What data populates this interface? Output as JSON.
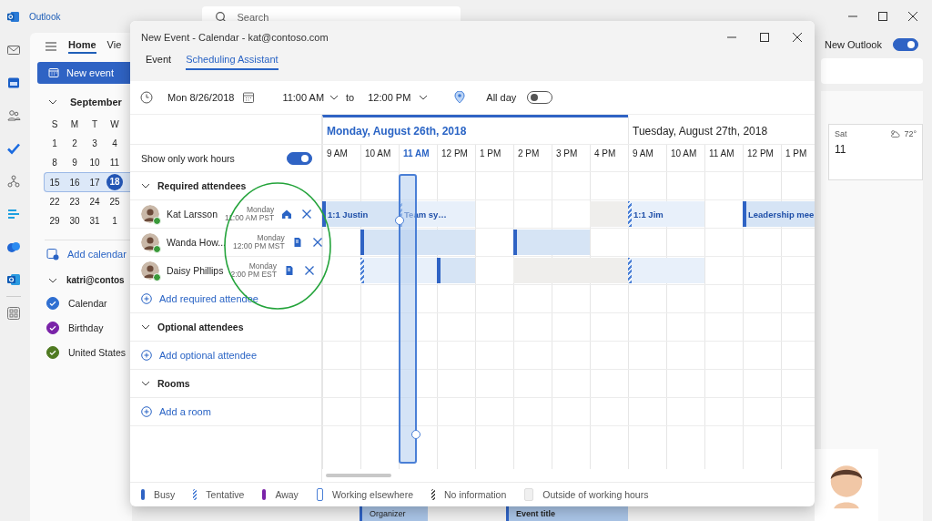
{
  "app": {
    "title": "Outlook",
    "search_placeholder": "Search",
    "new_outlook": {
      "label": "New Outlook",
      "on": true
    }
  },
  "ribbon": {
    "tabs": [
      {
        "label": "Home",
        "selected": true
      },
      {
        "label": "Vie",
        "selected": false
      }
    ],
    "new_event": "New event"
  },
  "mini_calendar": {
    "month": "September",
    "weekdays": [
      "S",
      "M",
      "T",
      "W"
    ],
    "weeks": [
      {
        "selected": false,
        "days": [
          {
            "day": "1",
            "today": false
          },
          {
            "day": "2",
            "today": false
          },
          {
            "day": "3",
            "today": false
          },
          {
            "day": "4",
            "today": false
          }
        ]
      },
      {
        "selected": false,
        "days": [
          {
            "day": "8",
            "today": false
          },
          {
            "day": "9",
            "today": false
          },
          {
            "day": "10",
            "today": false
          },
          {
            "day": "11",
            "today": false
          }
        ]
      },
      {
        "selected": true,
        "days": [
          {
            "day": "15",
            "today": false
          },
          {
            "day": "16",
            "today": false
          },
          {
            "day": "17",
            "today": false
          },
          {
            "day": "18",
            "today": true
          }
        ]
      },
      {
        "selected": false,
        "days": [
          {
            "day": "22",
            "today": false
          },
          {
            "day": "23",
            "today": false
          },
          {
            "day": "24",
            "today": false
          },
          {
            "day": "25",
            "today": false
          }
        ]
      },
      {
        "selected": false,
        "days": [
          {
            "day": "29",
            "today": false
          },
          {
            "day": "30",
            "today": false
          },
          {
            "day": "31",
            "today": false
          },
          {
            "day": "1",
            "today": false
          }
        ]
      }
    ]
  },
  "add_calendar": "Add calendar",
  "account": {
    "label": "katri@contos",
    "expanded": true
  },
  "calendars": [
    {
      "name": "Calendar",
      "color": "#2f6fd1",
      "checked": true
    },
    {
      "name": "Birthday",
      "color": "#7a23a8",
      "checked": true
    },
    {
      "name": "United States",
      "color": "#4f7a21",
      "checked": true
    }
  ],
  "right_pane": {
    "day": "Sat",
    "date": "11",
    "weather": "72°"
  },
  "background_events": [
    {
      "title": "Organizer"
    },
    {
      "title": "Event title"
    }
  ],
  "dialog": {
    "title": "New Event - Calendar - kat@contoso.com",
    "tabs": [
      {
        "label": "Event",
        "selected": false
      },
      {
        "label": "Scheduling Assistant",
        "selected": true
      }
    ],
    "date": "Mon 8/26/2018",
    "start": "11:00 AM",
    "to": "to",
    "end": "12:00 PM",
    "all_day": {
      "label": "All day",
      "on": false
    },
    "work_hours": {
      "label": "Show only work hours",
      "on": true
    },
    "days": [
      {
        "label": "Monday, August 26th, 2018",
        "selected": true,
        "hours": [
          {
            "label": "9 AM",
            "selected": false
          },
          {
            "label": "10 AM",
            "selected": false
          },
          {
            "label": "11 AM",
            "selected": true
          },
          {
            "label": "12 PM",
            "selected": false
          },
          {
            "label": "1 PM",
            "selected": false
          },
          {
            "label": "2 PM",
            "selected": false
          },
          {
            "label": "3 PM",
            "selected": false
          },
          {
            "label": "4 PM",
            "selected": false
          }
        ]
      },
      {
        "label": "Tuesday, August 27th, 2018",
        "selected": false,
        "hours": [
          {
            "label": "9 AM",
            "selected": false
          },
          {
            "label": "10 AM",
            "selected": false
          },
          {
            "label": "11 AM",
            "selected": false
          },
          {
            "label": "12 PM",
            "selected": false
          },
          {
            "label": "1 PM",
            "selected": false
          }
        ]
      }
    ],
    "sections": [
      {
        "label": "Required attendees",
        "expanded": true,
        "add": "Add required attendee",
        "attendees": [
          {
            "name": "Kat Larsson",
            "day": "Monday",
            "time": "11:00 AM PST",
            "works_from_home": true,
            "slots": [
              {
                "kind": "busy",
                "title": "1:1 Justin"
              },
              {
                "kind": "busy"
              },
              {
                "kind": "tentative",
                "title": "Team sy…"
              },
              {
                "kind": "tentative"
              },
              {
                "kind": "free"
              },
              {
                "kind": "free"
              },
              {
                "kind": "free"
              },
              {
                "kind": "outside"
              },
              {
                "kind": "tentative",
                "title": "1:1 Jim"
              },
              {
                "kind": "tentative"
              },
              {
                "kind": "free"
              },
              {
                "kind": "busy",
                "title": "Leadership mee"
              },
              {
                "kind": "busy"
              }
            ]
          },
          {
            "name": "Wanda How...",
            "day": "Monday",
            "time": "12:00 PM MST",
            "works_from_home": false,
            "slots": [
              {
                "kind": "free"
              },
              {
                "kind": "busy"
              },
              {
                "kind": "busy"
              },
              {
                "kind": "busy"
              },
              {
                "kind": "free"
              },
              {
                "kind": "busy"
              },
              {
                "kind": "busy"
              },
              {
                "kind": "free"
              },
              {
                "kind": "free"
              },
              {
                "kind": "free"
              },
              {
                "kind": "free"
              },
              {
                "kind": "free"
              },
              {
                "kind": "free"
              }
            ]
          },
          {
            "name": "Daisy Phillips",
            "day": "Monday",
            "time": "2:00 PM EST",
            "works_from_home": false,
            "slots": [
              {
                "kind": "free"
              },
              {
                "kind": "tentative"
              },
              {
                "kind": "tentative"
              },
              {
                "kind": "busy"
              },
              {
                "kind": "free"
              },
              {
                "kind": "outside"
              },
              {
                "kind": "outside"
              },
              {
                "kind": "outside"
              },
              {
                "kind": "tentative"
              },
              {
                "kind": "tentative"
              },
              {
                "kind": "free"
              },
              {
                "kind": "free"
              },
              {
                "kind": "free"
              }
            ]
          }
        ]
      },
      {
        "label": "Optional attendees",
        "expanded": true,
        "add": "Add optional attendee"
      },
      {
        "label": "Rooms",
        "expanded": true,
        "add": "Add a room"
      }
    ],
    "legend": [
      {
        "label": "Busy",
        "kind": "busy"
      },
      {
        "label": "Tentative",
        "kind": "tentative"
      },
      {
        "label": "Away",
        "kind": "away"
      },
      {
        "label": "Working elsewhere",
        "kind": "elsewhere"
      },
      {
        "label": "No information",
        "kind": "noinfo"
      },
      {
        "label": "Outside of working hours",
        "kind": "outside"
      }
    ]
  }
}
